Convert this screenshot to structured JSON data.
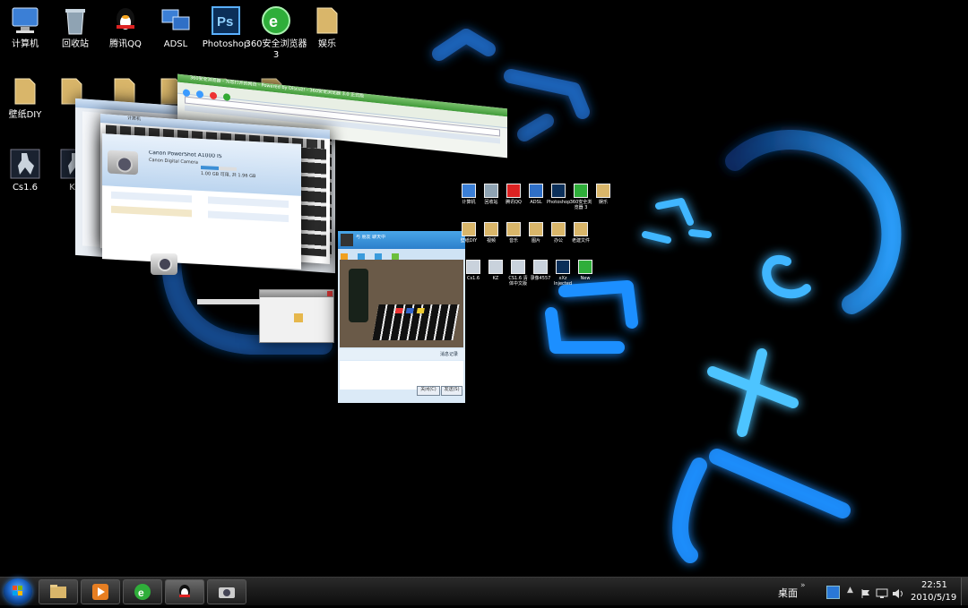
{
  "desktop": {
    "icons_row1": [
      {
        "label": "计算机",
        "icon": "computer-icon"
      },
      {
        "label": "回收站",
        "icon": "recycle-bin-icon"
      },
      {
        "label": "腾讯QQ",
        "icon": "qq-penguin-icon"
      },
      {
        "label": "ADSL",
        "icon": "network-connection-icon"
      },
      {
        "label": "Photoshop",
        "icon": "photoshop-icon"
      },
      {
        "label": "360安全浏览器 3",
        "icon": "360-browser-icon"
      },
      {
        "label": "娱乐",
        "icon": "folder-icon"
      }
    ],
    "icons_row2": [
      {
        "label": "壁纸DIY",
        "icon": "folder-icon"
      },
      {
        "label": "视频",
        "icon": "folder-icon"
      }
    ],
    "icons_row3": [
      {
        "label": "Cs1.6",
        "icon": "counter-strike-icon"
      },
      {
        "label": "KZ",
        "icon": "counter-strike-icon"
      }
    ],
    "mini_desktop": {
      "row1": [
        "计算机",
        "回收站",
        "腾讯QQ",
        "ADSL",
        "Photoshop",
        "360安全浏览器 3",
        "娱乐"
      ],
      "row2": [
        "壁纸DIY",
        "视频",
        "音乐",
        "图片",
        "办公",
        "老建文件"
      ],
      "row3": [
        "Cs1.6",
        "KZ",
        "CS1.6 清体中文版",
        "录像4557",
        "xXz Injected",
        "New"
      ]
    }
  },
  "windows": {
    "browser": {
      "title": "360安全浏览器 - 为您打开的网页 - Powered by Discuz! - 360安全浏览器 3.0 正式版"
    },
    "explorer": {
      "title": "计算机"
    },
    "camera_props": {
      "device_name": "Canon PowerShot A1000 IS",
      "device_sub": "Canon Digital Camera",
      "storage": "1.00 GB 可用, 共 1.96 GB"
    },
    "qq_chat": {
      "title": "与 朋友 聊天中",
      "close_button": "关闭(C)",
      "send_button": "发送(S)",
      "font_button": "消息记录"
    }
  },
  "taskbar": {
    "show_desktop_label": "桌面",
    "time": "22:51",
    "date": "2010/5/19",
    "buttons": [
      "explorer-button",
      "media-player-button",
      "browser-button",
      "qq-button",
      "camera-button"
    ]
  },
  "colors": {
    "wallpaper_glow": "#1e8fff",
    "wallpaper_core": "#5cc8ff",
    "taskbar": "#111111"
  }
}
